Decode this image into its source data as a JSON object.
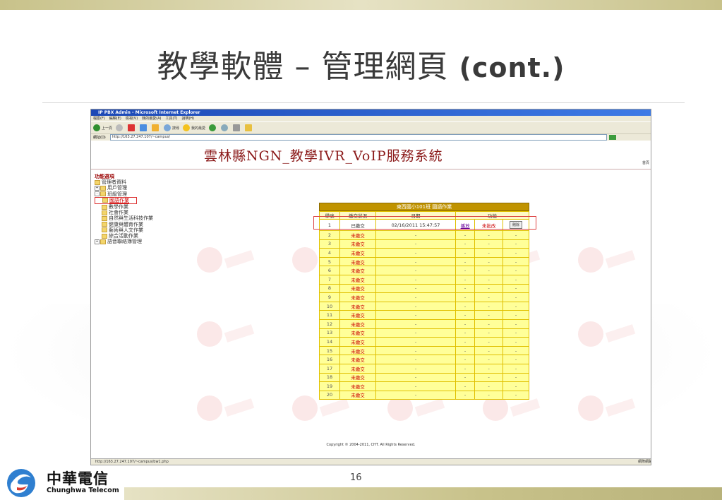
{
  "slide": {
    "title": "教學軟體 – 管理網頁",
    "title_cont": "(cont.)",
    "page_number": "16"
  },
  "browser": {
    "window_title": "IP PBX Admin - Microsoft Internet Explorer",
    "menu": [
      "檔案(F)",
      "編輯(E)",
      "檢視(V)",
      "我的最愛(A)",
      "工具(T)",
      "說明(H)"
    ],
    "toolbar": {
      "back": "上一頁",
      "search": "搜尋",
      "favorites": "我的最愛"
    },
    "address_label": "網址(D)",
    "address": "http://163.27.247.107/~campus/",
    "status_url": "http://163.27.247.107/~campus/bw1.php",
    "status_zone": "網際網路"
  },
  "site": {
    "title": "雲林縣NGN_教學IVR_VoIP服務系統",
    "home_link": "首頁"
  },
  "sidebar": {
    "heading": "功能選項",
    "items": [
      {
        "label": "管理者資料",
        "level": 1,
        "prefix": ""
      },
      {
        "label": "用戶管理",
        "level": 1,
        "prefix": "+"
      },
      {
        "label": "班級管理",
        "level": 1,
        "prefix": "-"
      },
      {
        "label": "國語作業",
        "level": 2,
        "prefix": "",
        "active": true
      },
      {
        "label": "數學作業",
        "level": 2,
        "prefix": ""
      },
      {
        "label": "社會作業",
        "level": 2,
        "prefix": ""
      },
      {
        "label": "自然與生活科技作業",
        "level": 2,
        "prefix": ""
      },
      {
        "label": "健康與體育作業",
        "level": 2,
        "prefix": ""
      },
      {
        "label": "藝術與人文作業",
        "level": 2,
        "prefix": ""
      },
      {
        "label": "綜合活動作業",
        "level": 2,
        "prefix": ""
      },
      {
        "label": "語音聯絡簿管理",
        "level": 1,
        "prefix": "+"
      }
    ]
  },
  "grade_table": {
    "caption": "東西國小101班 國語作業",
    "headers": [
      "學號",
      "繳交狀況",
      "日期",
      "功能"
    ],
    "rows": [
      {
        "id": "1",
        "status": "已繳交",
        "date": "02/16/2011 15:47:57",
        "play": "播放",
        "state": "未批改",
        "delete": "刪除"
      },
      {
        "id": "2",
        "status": "未繳交",
        "date": "-",
        "play": "-",
        "state": "-",
        "delete": "-"
      },
      {
        "id": "3",
        "status": "未繳交",
        "date": "-",
        "play": "-",
        "state": "-",
        "delete": "-"
      },
      {
        "id": "4",
        "status": "未繳交",
        "date": "-",
        "play": "-",
        "state": "-",
        "delete": "-"
      },
      {
        "id": "5",
        "status": "未繳交",
        "date": "-",
        "play": "-",
        "state": "-",
        "delete": "-"
      },
      {
        "id": "6",
        "status": "未繳交",
        "date": "-",
        "play": "-",
        "state": "-",
        "delete": "-"
      },
      {
        "id": "7",
        "status": "未繳交",
        "date": "-",
        "play": "-",
        "state": "-",
        "delete": "-"
      },
      {
        "id": "8",
        "status": "未繳交",
        "date": "-",
        "play": "-",
        "state": "-",
        "delete": "-"
      },
      {
        "id": "9",
        "status": "未繳交",
        "date": "-",
        "play": "-",
        "state": "-",
        "delete": "-"
      },
      {
        "id": "10",
        "status": "未繳交",
        "date": "-",
        "play": "-",
        "state": "-",
        "delete": "-"
      },
      {
        "id": "11",
        "status": "未繳交",
        "date": "-",
        "play": "-",
        "state": "-",
        "delete": "-"
      },
      {
        "id": "12",
        "status": "未繳交",
        "date": "-",
        "play": "-",
        "state": "-",
        "delete": "-"
      },
      {
        "id": "13",
        "status": "未繳交",
        "date": "-",
        "play": "-",
        "state": "-",
        "delete": "-"
      },
      {
        "id": "14",
        "status": "未繳交",
        "date": "-",
        "play": "-",
        "state": "-",
        "delete": "-"
      },
      {
        "id": "15",
        "status": "未繳交",
        "date": "-",
        "play": "-",
        "state": "-",
        "delete": "-"
      },
      {
        "id": "16",
        "status": "未繳交",
        "date": "-",
        "play": "-",
        "state": "-",
        "delete": "-"
      },
      {
        "id": "17",
        "status": "未繳交",
        "date": "-",
        "play": "-",
        "state": "-",
        "delete": "-"
      },
      {
        "id": "18",
        "status": "未繳交",
        "date": "-",
        "play": "-",
        "state": "-",
        "delete": "-"
      },
      {
        "id": "19",
        "status": "未繳交",
        "date": "-",
        "play": "-",
        "state": "-",
        "delete": "-"
      },
      {
        "id": "20",
        "status": "未繳交",
        "date": "-",
        "play": "-",
        "state": "-",
        "delete": "-"
      }
    ]
  },
  "copyright": "Copyright © 2004-2011, CHT. All Rights Reserved.",
  "logo": {
    "chinese": "中華電信",
    "english": "Chunghwa Telecom"
  },
  "colors": {
    "site_title": "#8b1a1a",
    "table_header": "#c09300",
    "table_cell": "#ffff99",
    "status_unsubmitted": "#cc0000",
    "highlight_box": "#dd4444"
  }
}
